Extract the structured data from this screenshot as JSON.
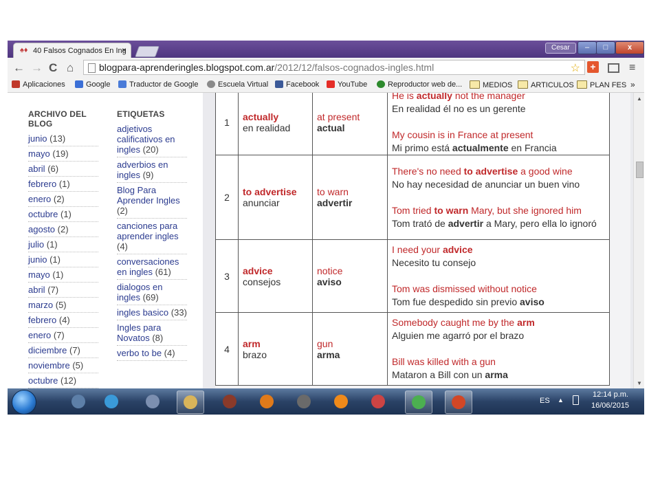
{
  "browser": {
    "tab_title": "40 Falsos Cognados En Ing",
    "tab_close": "×",
    "user": "Cesar",
    "window_buttons": {
      "min": "–",
      "max": "□",
      "close": "x"
    },
    "url_host": "blogpara-aprenderingles.blogspot.com.ar",
    "url_path": "/2012/12/falsos-cognados-ingles.html",
    "nav": {
      "back": "←",
      "forward": "→",
      "reload": "C",
      "home": "⌂"
    },
    "star": "☆",
    "menu": "≡"
  },
  "bookmarks": [
    {
      "label": "Aplicaciones",
      "icon": "apps-grid-icon",
      "color": "#c0392b"
    },
    {
      "label": "Google",
      "icon": "google-icon",
      "color": "#3b6fd6"
    },
    {
      "label": "Traductor de Google",
      "icon": "translate-icon",
      "color": "#4a7bd8"
    },
    {
      "label": "Escuela Virtual",
      "icon": "escuela-icon",
      "color": "#8a8a8a"
    },
    {
      "label": "Facebook",
      "icon": "facebook-icon",
      "color": "#3b5998"
    },
    {
      "label": "YouTube",
      "icon": "youtube-icon",
      "color": "#e52d27"
    },
    {
      "label": "Reproductor web de...",
      "icon": "spotify-icon",
      "color": "#2d8a2d"
    },
    {
      "label": "MEDIOS",
      "icon": "folder-icon",
      "color": "#f7e9a8"
    },
    {
      "label": "ARTICULOS",
      "icon": "folder-icon",
      "color": "#f7e9a8"
    },
    {
      "label": "PLAN FES",
      "icon": "folder-icon",
      "color": "#f7e9a8"
    }
  ],
  "bookmarks_more": "»",
  "sidebar": {
    "archive_title": "ARCHIVO DEL BLOG",
    "archive": [
      {
        "label": "junio",
        "count": "(13)"
      },
      {
        "label": "mayo",
        "count": "(19)"
      },
      {
        "label": "abril",
        "count": "(6)"
      },
      {
        "label": "febrero",
        "count": "(1)"
      },
      {
        "label": "enero",
        "count": "(2)"
      },
      {
        "label": "octubre",
        "count": "(1)"
      },
      {
        "label": "agosto",
        "count": "(2)"
      },
      {
        "label": "julio",
        "count": "(1)"
      },
      {
        "label": "junio",
        "count": "(1)"
      },
      {
        "label": "mayo",
        "count": "(1)"
      },
      {
        "label": "abril",
        "count": "(7)"
      },
      {
        "label": "marzo",
        "count": "(5)"
      },
      {
        "label": "febrero",
        "count": "(4)"
      },
      {
        "label": "enero",
        "count": "(7)"
      },
      {
        "label": "diciembre",
        "count": "(7)"
      },
      {
        "label": "noviembre",
        "count": "(5)"
      },
      {
        "label": "octubre",
        "count": "(12)"
      }
    ],
    "labels_title": "ETIQUETAS",
    "labels": [
      {
        "label": "adjetivos calificativos en ingles",
        "count": "(20)"
      },
      {
        "label": "adverbios en ingles",
        "count": "(9)"
      },
      {
        "label": "Blog Para Aprender Ingles",
        "count": "(2)"
      },
      {
        "label": "canciones para aprender ingles",
        "count": "(4)"
      },
      {
        "label": "conversaciones en ingles",
        "count": "(61)"
      },
      {
        "label": "dialogos en ingles",
        "count": "(69)"
      },
      {
        "label": "ingles basico",
        "count": "(33)"
      },
      {
        "label": "Ingles para Novatos",
        "count": "(8)"
      },
      {
        "label": "verbo to be",
        "count": "(4)"
      }
    ]
  },
  "table": [
    {
      "num": "1",
      "en_word": "actually",
      "es_word": "en realidad",
      "false_en": "at present",
      "false_es": "actual",
      "ex1_en": [
        "He is ",
        "actually",
        " not the manager"
      ],
      "ex1_es": [
        "En realidad él no es un gerente",
        "",
        ""
      ],
      "ex2_en": [
        "My cousin is in France at present",
        "",
        ""
      ],
      "ex2_es": [
        "Mi primo está ",
        "actualmente",
        " en Francia"
      ]
    },
    {
      "num": "2",
      "en_word": "to advertise",
      "es_word": "anunciar",
      "false_en": "to warn",
      "false_es": "advertir",
      "ex1_en": [
        "There's no need ",
        "to advertise",
        " a good wine"
      ],
      "ex1_es": [
        "No hay necesidad de anunciar un buen vino",
        "",
        ""
      ],
      "ex2_en": [
        "Tom tried ",
        "to warn",
        " Mary, but she ignored him"
      ],
      "ex2_es": [
        "Tom trató de ",
        "advertir",
        " a Mary, pero ella lo ignoró"
      ]
    },
    {
      "num": "3",
      "en_word": "advice",
      "es_word": "consejos",
      "false_en": "notice",
      "false_es": "aviso",
      "ex1_en": [
        "I need your ",
        "advice",
        ""
      ],
      "ex1_es": [
        "Necesito tu consejo",
        "",
        ""
      ],
      "ex2_en": [
        "Tom was dismissed without notice",
        "",
        ""
      ],
      "ex2_es": [
        "Tom fue despedido sin previo ",
        "aviso",
        ""
      ]
    },
    {
      "num": "4",
      "en_word": "arm",
      "es_word": "brazo",
      "false_en": "gun",
      "false_es": "arma",
      "ex1_en": [
        "Somebody caught me by the ",
        "arm",
        ""
      ],
      "ex1_es": [
        "Alguien me agarró por el brazo",
        "",
        ""
      ],
      "ex2_en": [
        "Bill was killed with a gun",
        "",
        ""
      ],
      "ex2_es": [
        "Mataron a Bill con un ",
        "arma",
        ""
      ]
    }
  ],
  "taskbar": {
    "apps": [
      "webcam-icon",
      "ie-icon",
      "tools-icon",
      "explorer-icon",
      "audio-icon",
      "media-player-icon",
      "film-icon",
      "vlc-icon",
      "network-icon",
      "chrome-icon",
      "powerpoint-icon"
    ],
    "active_apps": [
      "explorer-icon",
      "chrome-icon",
      "powerpoint-icon"
    ],
    "lang": "ES",
    "tray_arrow": "▲",
    "time": "12:14 p.m.",
    "date": "16/06/2015"
  }
}
